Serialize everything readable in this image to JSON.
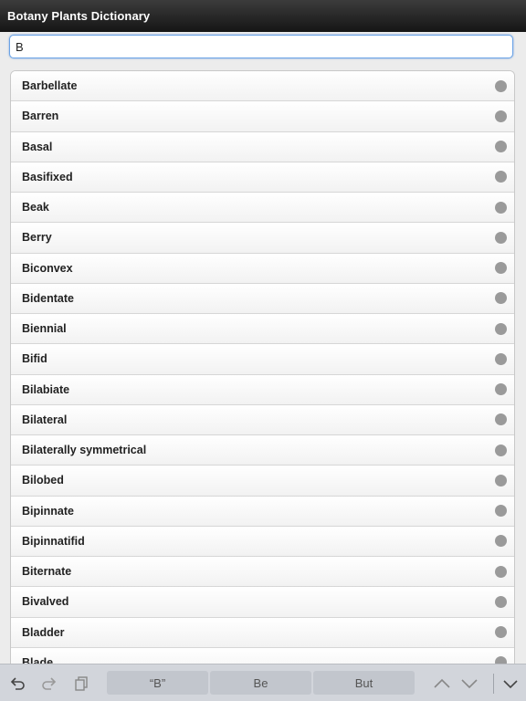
{
  "app": {
    "title": "Botany Plants Dictionary"
  },
  "search": {
    "value": "B"
  },
  "list": {
    "items": [
      "Barbellate",
      "Barren",
      "Basal",
      "Basifixed",
      "Beak",
      "Berry",
      "Biconvex",
      "Bidentate",
      "Biennial",
      "Bifid",
      "Bilabiate",
      "Bilateral",
      "Bilaterally symmetrical",
      "Bilobed",
      "Bipinnate",
      "Bipinnatifid",
      "Biternate",
      "Bivalved",
      "Bladder",
      "Blade"
    ],
    "indicator_color": "#9a9a9a"
  },
  "keyboard": {
    "suggestions": [
      "“B”",
      "Be",
      "But"
    ],
    "icons": [
      "undo-icon",
      "redo-icon",
      "paste-icon",
      "chevron-up-icon",
      "chevron-down-icon",
      "dismiss-keyboard-icon"
    ]
  }
}
